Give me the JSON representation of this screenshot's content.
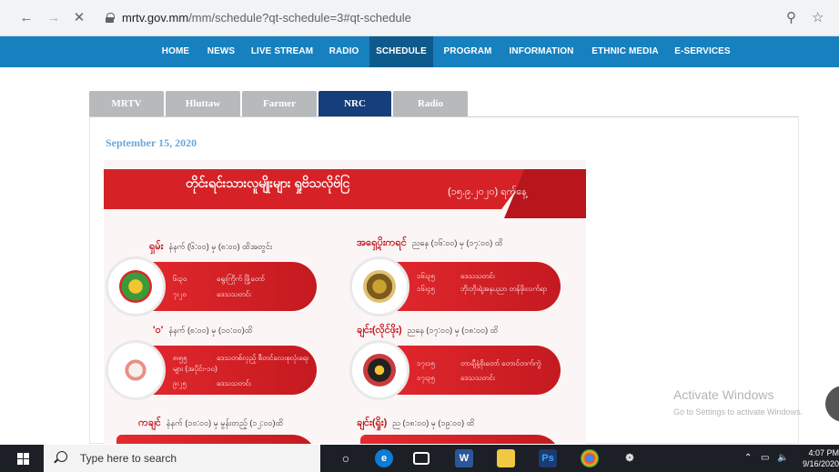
{
  "browser": {
    "url_domain": "mrtv.gov.mm",
    "url_path": "/mm/schedule?qt-schedule=3#qt-schedule"
  },
  "nav": {
    "items": [
      "HOME",
      "NEWS",
      "LIVE STREAM",
      "RADIO",
      "SCHEDULE",
      "PROGRAM",
      "INFORMATION",
      "ETHNIC MEDIA",
      "E-SERVICES"
    ],
    "active": "SCHEDULE"
  },
  "tabs": [
    "MRTV",
    "Hluttaw",
    "Farmer",
    "NRC",
    "Radio"
  ],
  "active_tab": "NRC",
  "schedule": {
    "date": "September 15, 2020",
    "banner_title": "တိုင်းရင်းသားလူမျိုးများ ရှုဗိသလိုဗ်ငြ",
    "banner_date": "(၁၅.၉.၂၀၂၀) ရက်နေ့",
    "sections": [
      {
        "title": "ရှမ်း",
        "time": "နံနက် (၆:၀၀) မှ (၈:၀၀) ထိအတွင်း",
        "rows": [
          {
            "time": "၆း၃၀",
            "text": "ရွေးကြိုက် ဖြို့တော်"
          },
          {
            "time": "၇း၂၀",
            "text": "ဒေသသတင်း"
          }
        ]
      },
      {
        "title": "အရှေ့ပိုးကရင်",
        "time": "ညနေ (၁၆:၀၀) မှ (၁၇:၀၀) ထိ",
        "rows": [
          {
            "time": "၁၆း၃၅",
            "text": "ဒေသသတင်း"
          },
          {
            "time": "၁၆း၄၅",
            "text": "ဘိုးဘိုးရဲ့အနုပညာ တန်ဖိုးလက်ရာ"
          }
        ]
      },
      {
        "title": "'ဝ'",
        "time": "နံနက် (၈:၀၀) မှ (၁၀:၀၀)ထိ",
        "rows": [
          {
            "time": "၈း၅၅",
            "text": "ဒေသတစ်လှည့် စီတင်လေးစုလုံးရေးများ (အပိုင်း-၁၀)"
          },
          {
            "time": "၉း၂၅",
            "text": "ဒေသသတင်း"
          }
        ]
      },
      {
        "title": "ချင်း(လိုင်ဖိုး)",
        "time": "ညနေ (၁၇:၀၀) မှ (၁၈:၀၀) ထိ",
        "rows": [
          {
            "time": "၁၇း၁၅",
            "text": "တာချီနဲ့စိုးတော် တောင်တက်ကွဲ"
          },
          {
            "time": "၁၇း၃၅",
            "text": "ဒေသသတင်း"
          }
        ]
      },
      {
        "title": "ကချင်",
        "time": "နံနက် (၁၀:၀၀) မှ မွန်းတည့် (၁၂:၀၀)ထိ"
      },
      {
        "title": "ချင်း(ရှိုး)",
        "time": "ည (၁၈:၀၀) မှ (၁၉:၀၀) ထိ"
      }
    ]
  },
  "watermark": {
    "title": "Activate Windows",
    "subtitle": "Go to Settings to activate Windows."
  },
  "taskbar": {
    "search_placeholder": "Type here to search",
    "time": "4:07 PM",
    "date": "9/16/2020"
  }
}
